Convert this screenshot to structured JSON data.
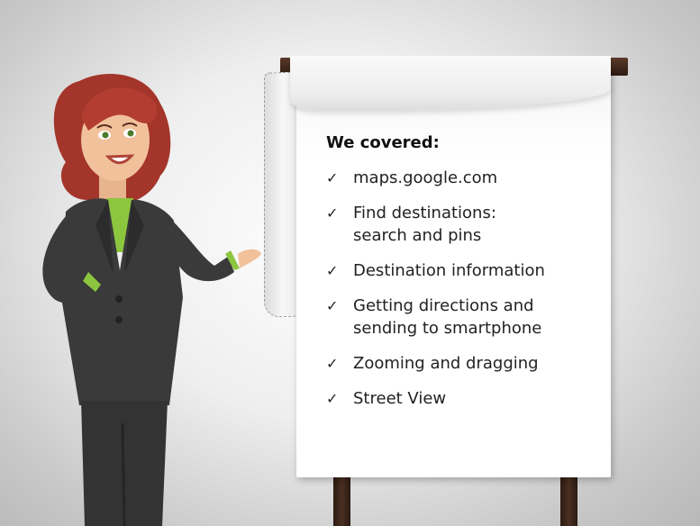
{
  "flipchart": {
    "heading": "We covered:",
    "items": [
      {
        "lines": [
          "maps.google.com"
        ]
      },
      {
        "lines": [
          "Find destinations:",
          "search and pins"
        ]
      },
      {
        "lines": [
          "Destination information"
        ]
      },
      {
        "lines": [
          "Getting directions and",
          "sending to smartphone"
        ]
      },
      {
        "lines": [
          "Zooming and dragging"
        ]
      },
      {
        "lines": [
          "Street View"
        ]
      }
    ],
    "check_glyph": "✓"
  },
  "icons": {
    "presenter": "presenter-woman-illustration",
    "easel": "flipchart-easel"
  },
  "colors": {
    "background": "#e9e9e9",
    "easel_wood": "#3b2419",
    "hair": "#a3352a",
    "suit": "#3a3a3a",
    "shirt": "#8cc63f",
    "skin": "#f1c19c"
  }
}
